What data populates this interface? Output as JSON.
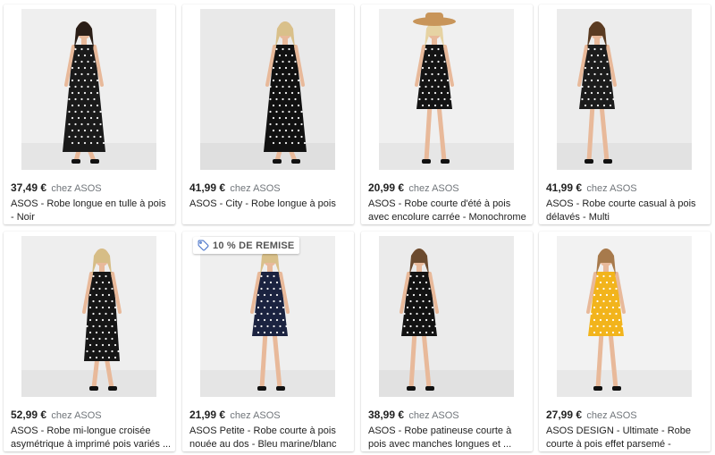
{
  "products": [
    {
      "price": "37,49 €",
      "seller": "chez ASOS",
      "title": "ASOS - Robe longue en tulle à pois - Noir",
      "badge": null,
      "dress_color": "#1a1a1a",
      "bg": "#efefef"
    },
    {
      "price": "41,99 €",
      "seller": "chez ASOS",
      "title": "ASOS - City - Robe longue à pois",
      "badge": null,
      "dress_color": "#111111",
      "bg": "#e9e9e9"
    },
    {
      "price": "20,99 €",
      "seller": "chez ASOS",
      "title": "ASOS - Robe courte d'été à pois avec encolure carrée - Monochrome ...",
      "badge": null,
      "dress_color": "#141414",
      "bg": "#f0f0f0"
    },
    {
      "price": "41,99 €",
      "seller": "chez ASOS",
      "title": "ASOS - Robe courte casual à pois délavés - Multi",
      "badge": null,
      "dress_color": "#1c1c1c",
      "bg": "#ececec"
    },
    {
      "price": "52,99 €",
      "seller": "chez ASOS",
      "title": "ASOS - Robe mi-longue croisée asymétrique à imprimé pois variés ...",
      "badge": null,
      "dress_color": "#161616",
      "bg": "#eeeeee"
    },
    {
      "price": "21,99 €",
      "seller": "chez ASOS",
      "title": "ASOS Petite - Robe courte à pois nouée au dos - Bleu marine/blanc",
      "badge": "10 % DE REMISE",
      "dress_color": "#1b2340",
      "bg": "#efefef"
    },
    {
      "price": "38,99 €",
      "seller": "chez ASOS",
      "title": "ASOS - Robe patineuse courte à pois avec manches longues et ...",
      "badge": null,
      "dress_color": "#121212",
      "bg": "#ebebeb"
    },
    {
      "price": "27,99 €",
      "seller": "chez ASOS",
      "title": "ASOS DESIGN - Ultimate - Robe courte à pois effet parsemé - Mustard",
      "badge": null,
      "dress_color": "#f2b41c",
      "bg": "#f2f2f2"
    }
  ]
}
